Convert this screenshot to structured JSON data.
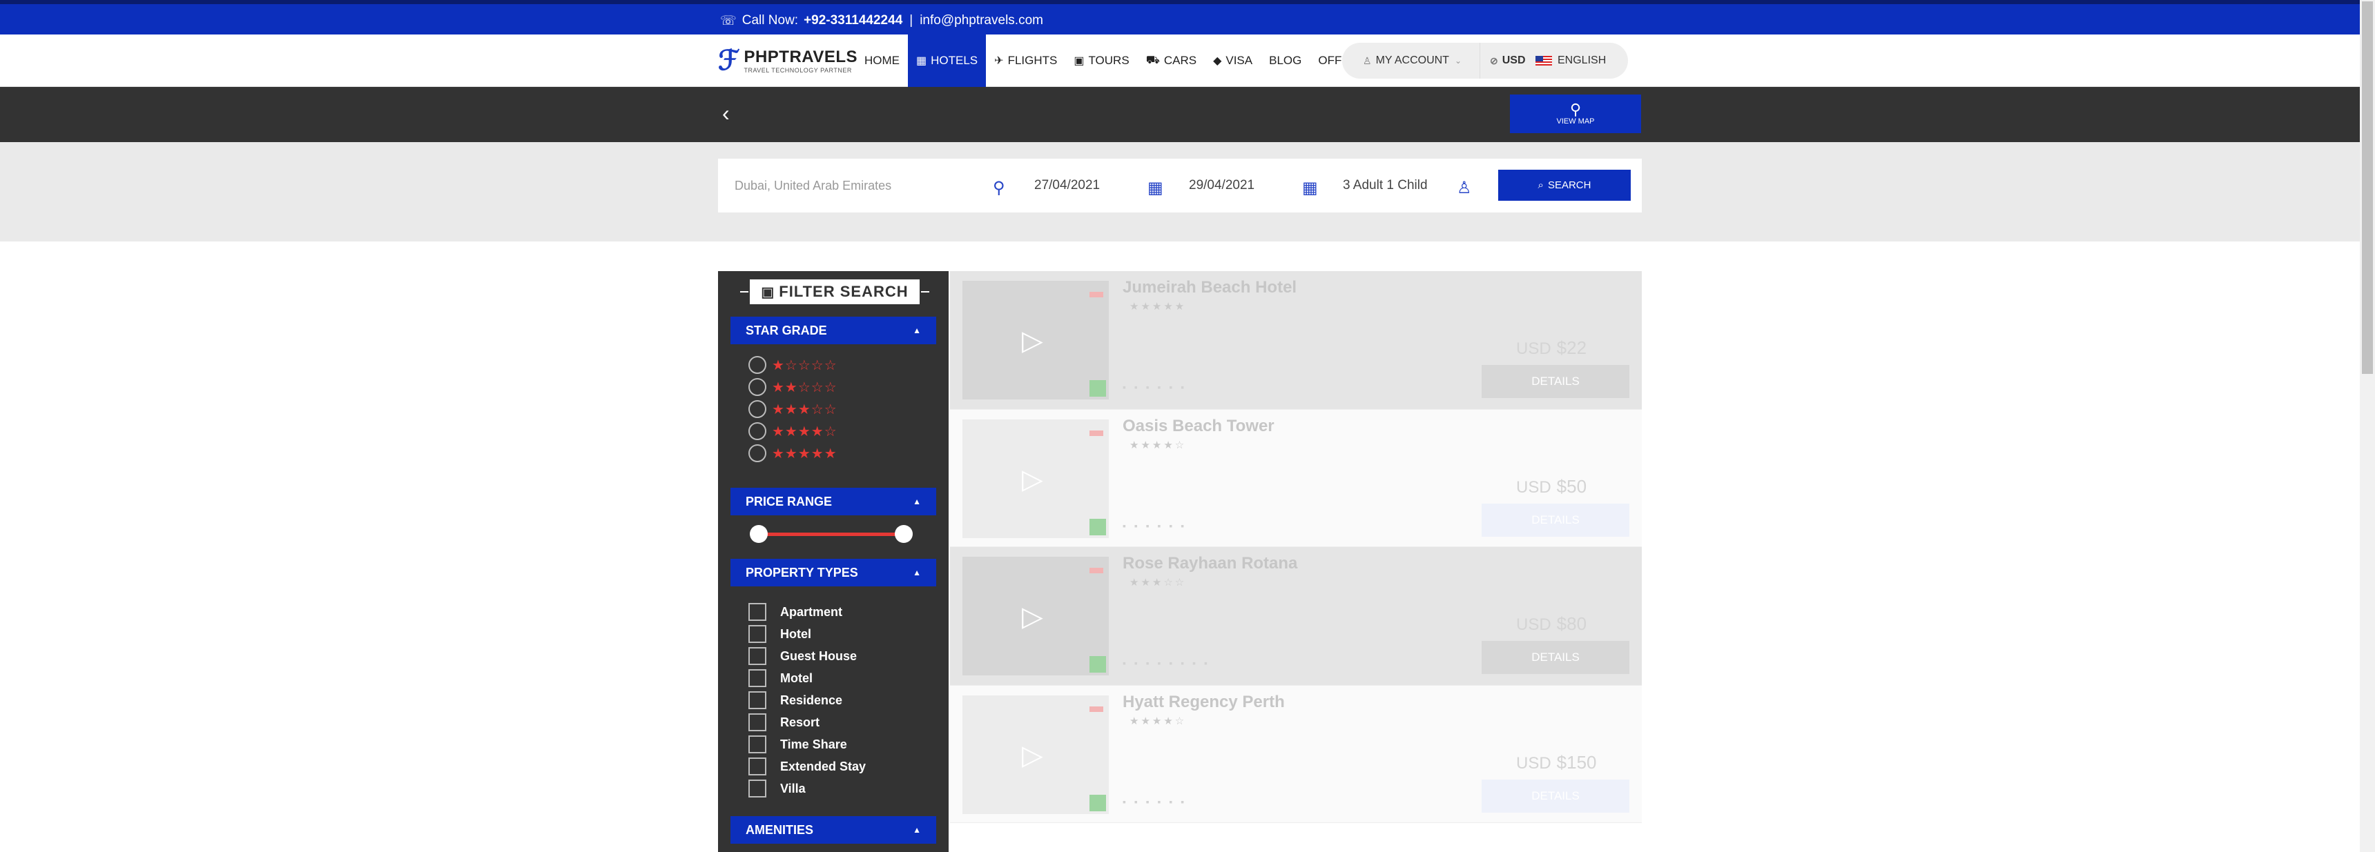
{
  "topbar": {
    "call_label": "Call Now:",
    "phone": "+92-3311442244",
    "separator": "|",
    "email": "info@phptravels.com"
  },
  "logo": {
    "name": "PHPTRAVELS",
    "tagline": "TRAVEL TECHNOLOGY PARTNER"
  },
  "menu": [
    {
      "label": "Home",
      "icon": ""
    },
    {
      "label": "Hotels",
      "icon": "building-icon",
      "active": true
    },
    {
      "label": "Flights",
      "icon": "plane-icon"
    },
    {
      "label": "Tours",
      "icon": "suitcase-icon"
    },
    {
      "label": "Cars",
      "icon": "car-icon"
    },
    {
      "label": "Visa",
      "icon": "tag-icon"
    },
    {
      "label": "Blog",
      "icon": ""
    },
    {
      "label": "Offers",
      "icon": ""
    }
  ],
  "account": {
    "label": "MY ACCOUNT",
    "currency": "USD",
    "language": "ENGLISH"
  },
  "map": {
    "label": "VIEW MAP"
  },
  "search": {
    "location_placeholder": "Dubai, United Arab Emirates",
    "checkin": "27/04/2021",
    "checkout": "29/04/2021",
    "guests": "3 Adult 1 Child",
    "button": "SEARCH"
  },
  "filter": {
    "title": "FILTER SEARCH",
    "star_grade": "STAR GRADE",
    "stars": [
      "★☆☆☆☆",
      "★★☆☆☆",
      "★★★☆☆",
      "★★★★☆",
      "★★★★★"
    ],
    "price_range": "PRICE RANGE",
    "property_types": "PROPERTY TYPES",
    "types": [
      "Apartment",
      "Hotel",
      "Guest House",
      "Motel",
      "Residence",
      "Resort",
      "Time Share",
      "Extended Stay",
      "Villa"
    ],
    "amenities": "AMENITIES",
    "arrow": "▲"
  },
  "hotels": [
    {
      "name": "Jumeirah Beach Hotel",
      "price": "$22",
      "currency": "USD",
      "details": "DETAILS"
    },
    {
      "name": "Oasis Beach Tower",
      "price": "$50",
      "currency": "USD",
      "details": "DETAILS"
    },
    {
      "name": "Rose Rayhaan Rotana",
      "price": "$80",
      "currency": "USD",
      "details": "DETAILS"
    },
    {
      "name": "Hyatt Regency Perth",
      "price": "$150",
      "currency": "USD",
      "details": "DETAILS"
    }
  ],
  "colors": {
    "brand": "#0c2fbc",
    "dark": "#333333",
    "star": "#e53935"
  }
}
